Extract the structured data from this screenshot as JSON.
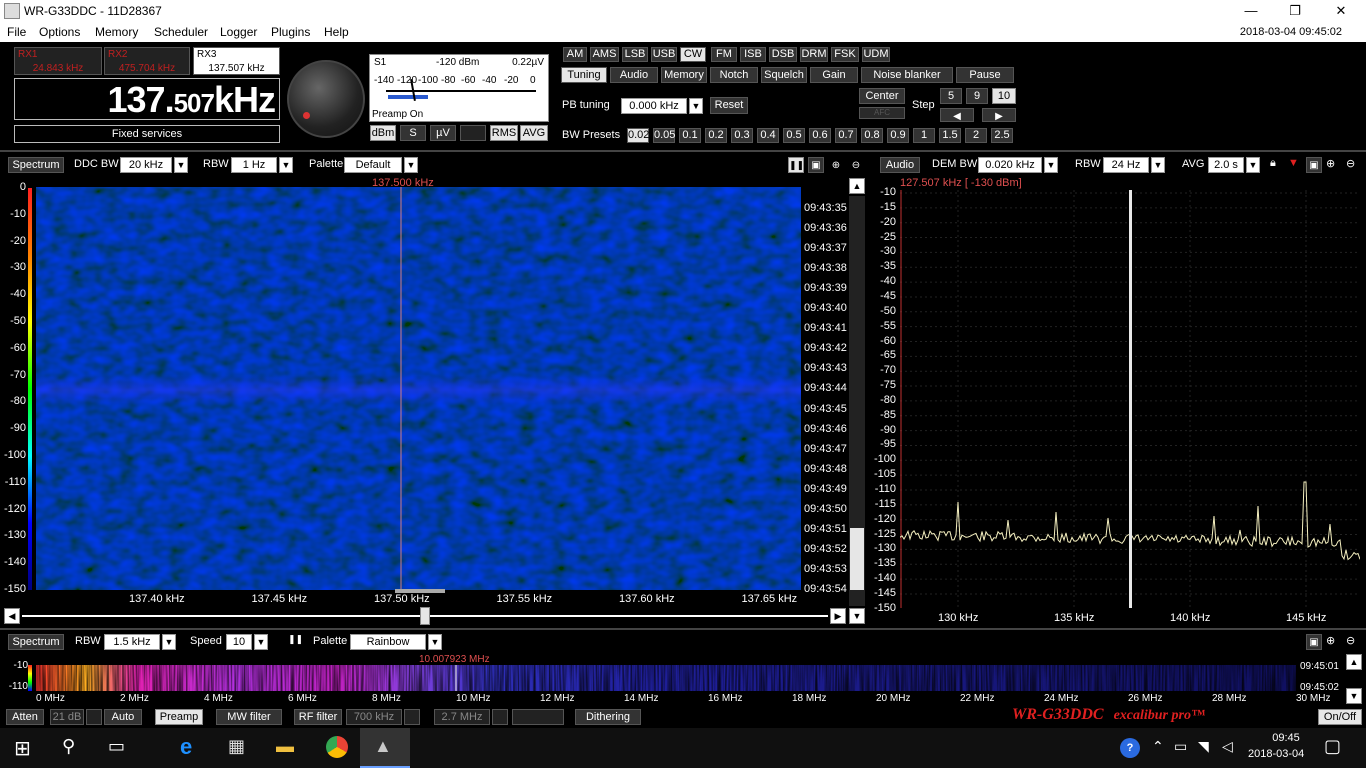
{
  "window": {
    "title": "WR-G33DDC - 11D28367",
    "minimize": "—",
    "maximize": "❐",
    "close": "✕"
  },
  "menu": {
    "items": [
      "File",
      "Options",
      "Memory",
      "Scheduler",
      "Logger",
      "Plugins",
      "Help"
    ],
    "datetime": "2018-03-04 09:45:02"
  },
  "receivers": [
    {
      "name": "RX1",
      "freq": "24.843 kHz"
    },
    {
      "name": "RX2",
      "freq": "475.704 kHz"
    },
    {
      "name": "RX3",
      "freq": "137.507 kHz"
    }
  ],
  "main_freq": {
    "int_part": "137.",
    "dec_part": "507",
    "unit": "kHz"
  },
  "service": "Fixed services",
  "meter": {
    "s": "S1",
    "dbm": "-120 dBm",
    "uv": "0.22µV",
    "scale": [
      "-140",
      "-120",
      "-100",
      "-80",
      "-60",
      "-40",
      "-20",
      "0"
    ],
    "preamp": "Preamp On"
  },
  "meter_buttons": [
    "dBm",
    "S",
    "µV",
    "",
    "RMS",
    "AVG"
  ],
  "modes": [
    "AM",
    "AMS",
    "LSB",
    "USB",
    "CW",
    "FM",
    "ISB",
    "DSB",
    "DRM",
    "FSK",
    "UDM"
  ],
  "active_mode": "CW",
  "tabs": [
    "Tuning",
    "Audio",
    "Memory",
    "Notch",
    "Squelch",
    "Gain",
    "Noise blanker",
    "Pause"
  ],
  "tuning": {
    "pb_label": "PB tuning",
    "pb_value": "0.000 kHz",
    "reset": "Reset",
    "center": "Center",
    "afc": "AFC",
    "step_label": "Step",
    "steps": [
      "5",
      "9",
      "10"
    ],
    "bw_label": "BW Presets",
    "presets": [
      "0.02",
      "0.05",
      "0.1",
      "0.2",
      "0.3",
      "0.4",
      "0.5",
      "0.6",
      "0.7",
      "0.8",
      "0.9",
      "1",
      "1.5",
      "2",
      "2.5"
    ]
  },
  "spectrum_bar": {
    "spectrum": "Spectrum",
    "ddc_label": "DDC BW",
    "ddc": "20 kHz",
    "rbw_label": "RBW",
    "rbw": "1 Hz",
    "palette_label": "Palette",
    "palette": "Default",
    "marker": "137.500 kHz"
  },
  "waterfall": {
    "y_ticks": [
      "0",
      "-10",
      "-20",
      "-30",
      "-40",
      "-50",
      "-60",
      "-70",
      "-80",
      "-90",
      "-100",
      "-110",
      "-120",
      "-130",
      "-140",
      "-150"
    ],
    "x_ticks": [
      "137.40 kHz",
      "137.45 kHz",
      "137.50 kHz",
      "137.55 kHz",
      "137.60 kHz",
      "137.65 kHz"
    ],
    "times": [
      "09:43:35",
      "09:43:36",
      "09:43:37",
      "09:43:38",
      "09:43:39",
      "09:43:40",
      "09:43:41",
      "09:43:42",
      "09:43:43",
      "09:43:44",
      "09:43:45",
      "09:43:46",
      "09:43:47",
      "09:43:48",
      "09:43:49",
      "09:43:50",
      "09:43:51",
      "09:43:52",
      "09:43:53",
      "09:43:54"
    ]
  },
  "audio_bar": {
    "audio": "Audio",
    "dem_label": "DEM BW",
    "dem": "0.020 kHz",
    "rbw_label": "RBW",
    "rbw": "24 Hz",
    "avg_label": "AVG",
    "avg": "2.0 s",
    "marker": "127.507 kHz [ -130 dBm]"
  },
  "audio_spectrum": {
    "y_ticks": [
      "-10",
      "-15",
      "-20",
      "-25",
      "-30",
      "-35",
      "-40",
      "-45",
      "-50",
      "-55",
      "-60",
      "-65",
      "-70",
      "-75",
      "-80",
      "-85",
      "-90",
      "-95",
      "-100",
      "-105",
      "-110",
      "-115",
      "-120",
      "-125",
      "-130",
      "-135",
      "-140",
      "-145",
      "-150"
    ],
    "x_ticks": [
      "130 kHz",
      "135 kHz",
      "140 kHz",
      "145 kHz"
    ]
  },
  "wide_bar": {
    "spectrum": "Spectrum",
    "rbw_label": "RBW",
    "rbw": "1.5 kHz",
    "speed_label": "Speed",
    "speed": "10",
    "palette_label": "Palette",
    "palette": "Rainbow",
    "marker": "10.007923 MHz",
    "y_ticks": [
      "-10",
      "-110"
    ],
    "times": [
      "09:45:01",
      "09:45:02"
    ],
    "x_ticks": [
      "0 MHz",
      "2 MHz",
      "4 MHz",
      "6 MHz",
      "8 MHz",
      "10 MHz",
      "12 MHz",
      "14 MHz",
      "16 MHz",
      "18 MHz",
      "20 MHz",
      "22 MHz",
      "24 MHz",
      "26 MHz",
      "28 MHz",
      "30 MHz"
    ]
  },
  "bottom_bar": {
    "atten": "Atten",
    "atten_val": "21 dB",
    "auto": "Auto",
    "preamp": "Preamp",
    "mw": "MW filter",
    "rf": "RF filter",
    "rf_val": "700 kHz",
    "rf_val2": "2.7 MHz",
    "dithering": "Dithering",
    "onoff": "On/Off"
  },
  "brand": {
    "model": "WR-G33DDC",
    "edition": "excalibur pro™"
  },
  "taskbar": {
    "time": "09:45",
    "date": "2018-03-04"
  },
  "colors": {
    "accent_red": "#e02020",
    "waterfall": "#0a0a3a"
  }
}
